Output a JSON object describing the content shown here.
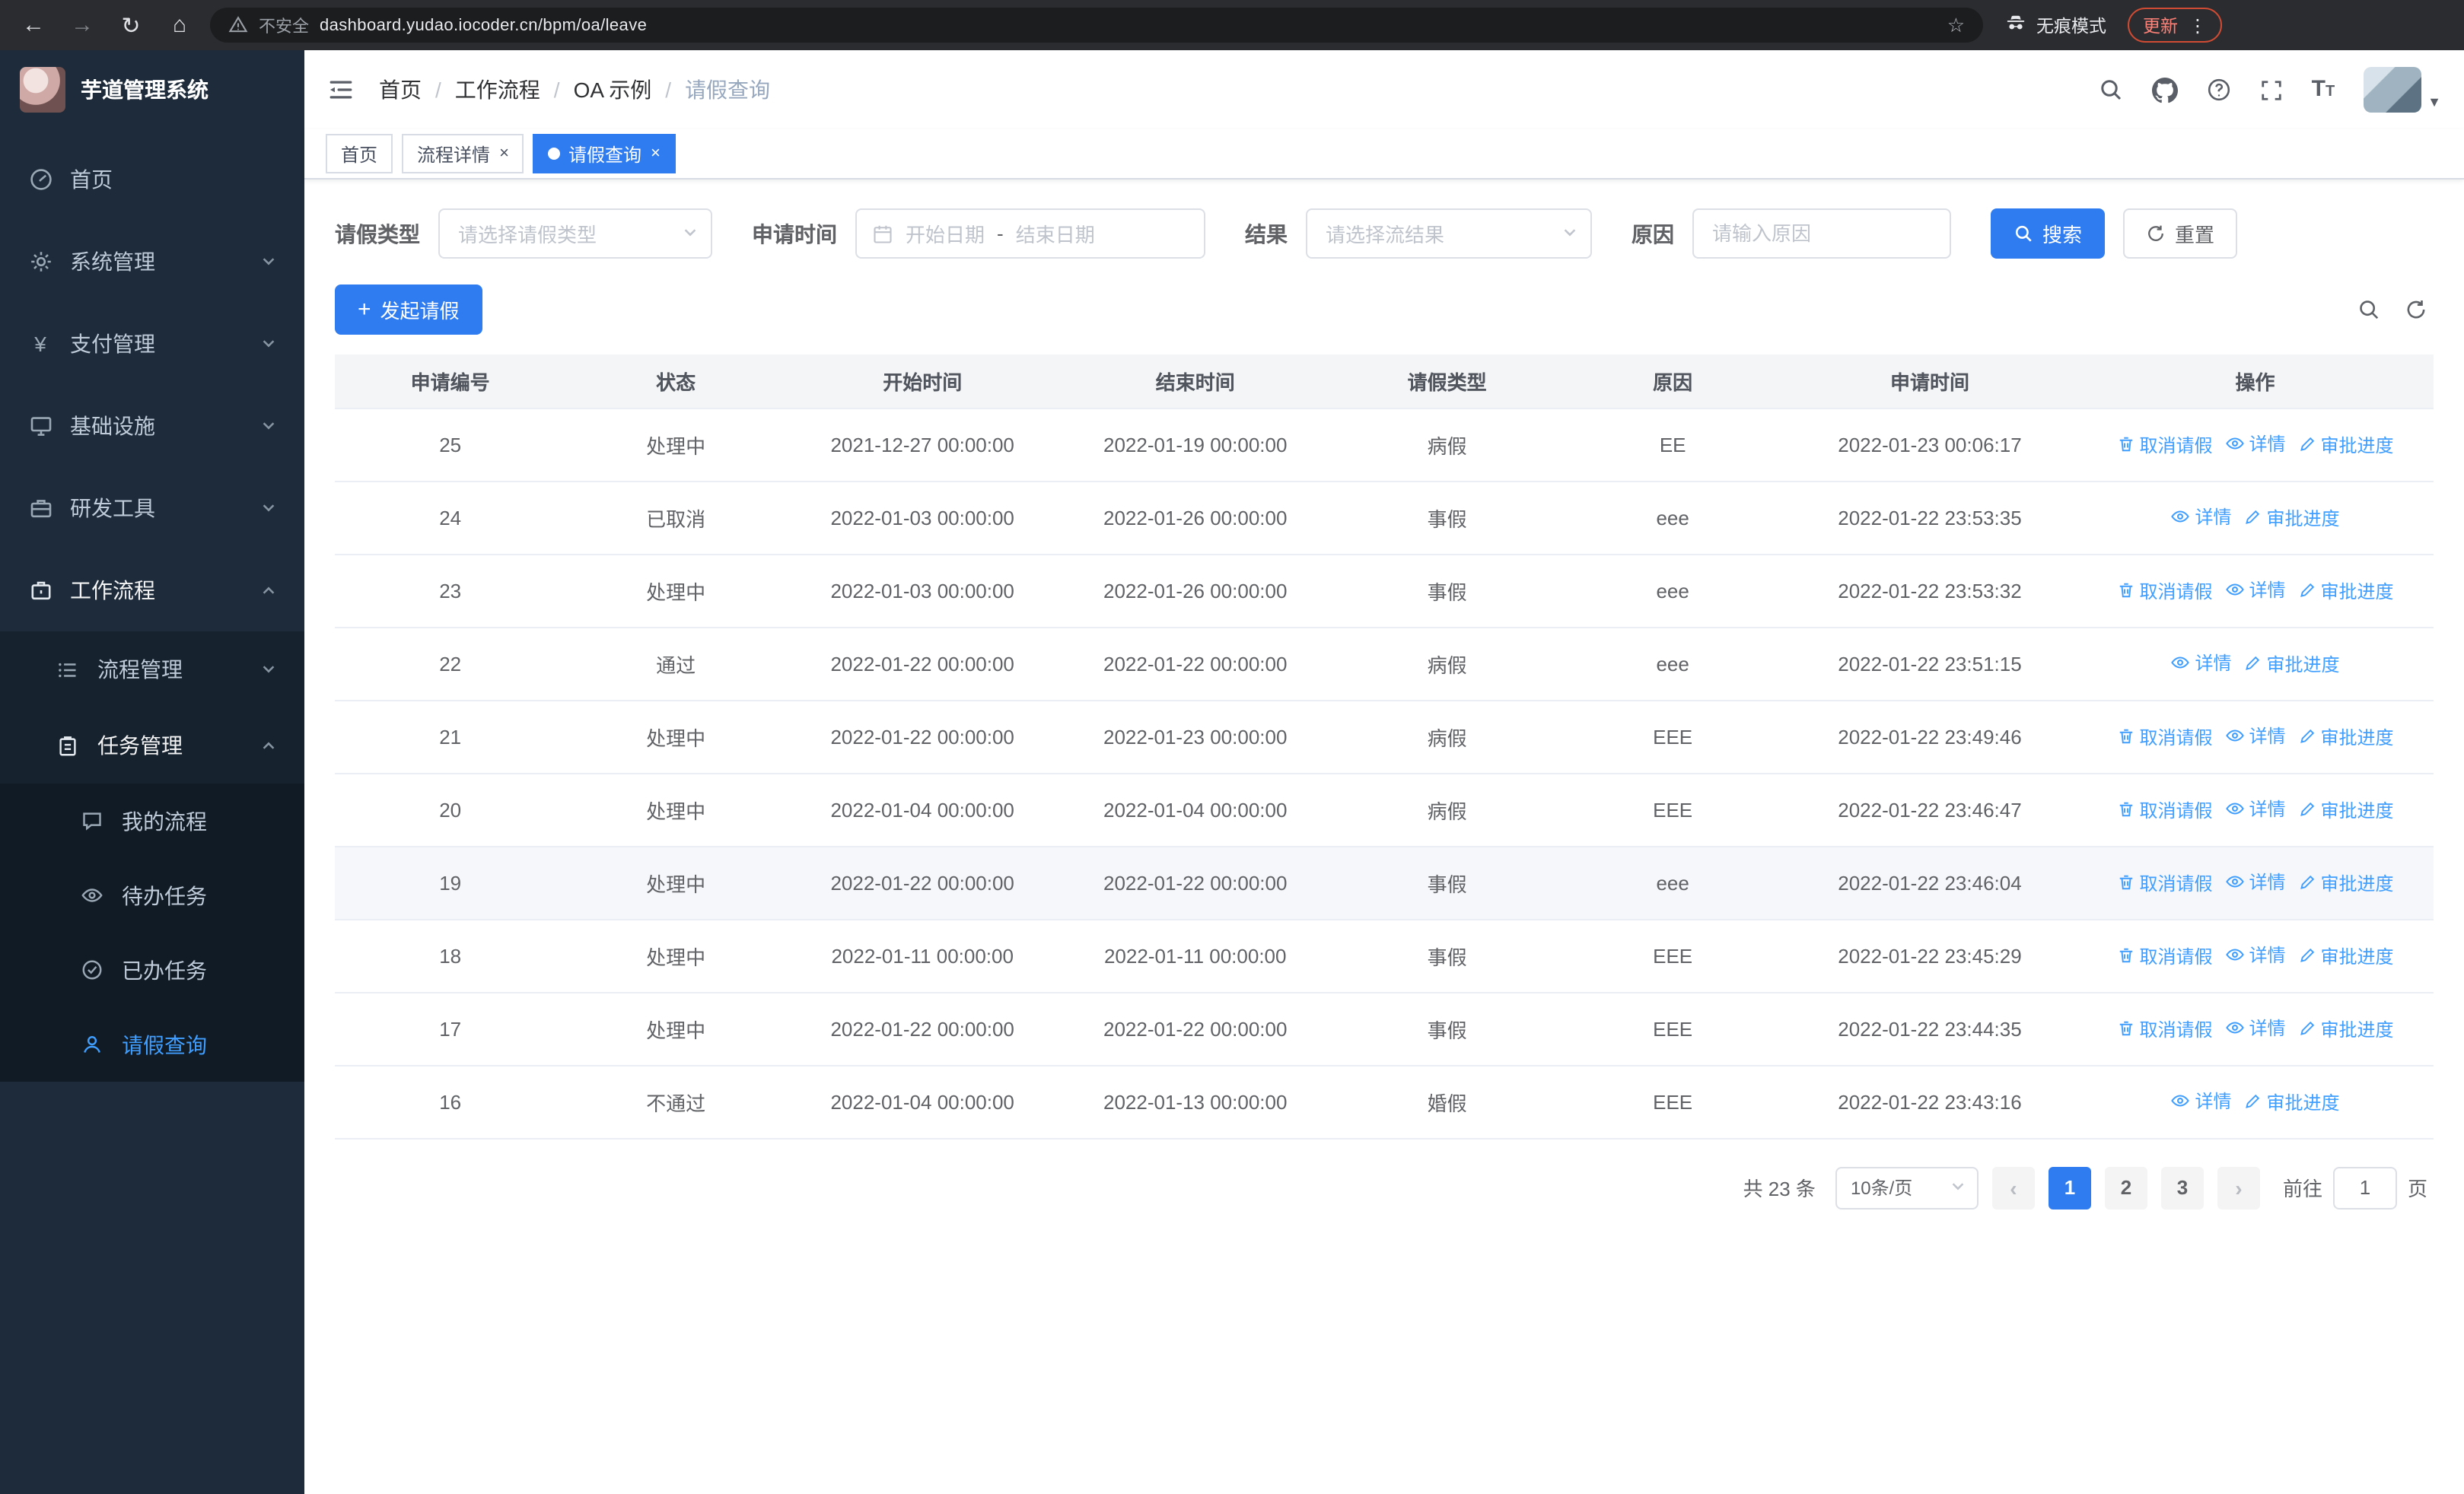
{
  "browser": {
    "security_label": "不安全",
    "url": "dashboard.yudao.iocoder.cn/bpm/oa/leave",
    "incognito_label": "无痕模式",
    "update_label": "更新"
  },
  "app_title": "芋道管理系统",
  "sidebar": {
    "items": [
      {
        "label": "首页",
        "icon": "dashboard-icon"
      },
      {
        "label": "系统管理",
        "icon": "gear-icon"
      },
      {
        "label": "支付管理",
        "icon": "yen-icon"
      },
      {
        "label": "基础设施",
        "icon": "monitor-icon"
      },
      {
        "label": "研发工具",
        "icon": "toolbox-icon"
      },
      {
        "label": "工作流程",
        "icon": "briefcase-icon"
      }
    ],
    "workflow_children": [
      {
        "label": "流程管理",
        "icon": "list-icon"
      },
      {
        "label": "任务管理",
        "icon": "clipboard-icon"
      }
    ],
    "task_children": [
      {
        "label": "我的流程",
        "icon": "chat-icon"
      },
      {
        "label": "待办任务",
        "icon": "eye-icon"
      },
      {
        "label": "已办任务",
        "icon": "check-icon"
      },
      {
        "label": "请假查询",
        "icon": "user-icon",
        "active": true
      }
    ]
  },
  "breadcrumb": {
    "items": [
      "首页",
      "工作流程",
      "OA 示例",
      "请假查询"
    ]
  },
  "tabs": [
    {
      "label": "首页",
      "closable": false,
      "active": false
    },
    {
      "label": "流程详情",
      "closable": true,
      "active": false
    },
    {
      "label": "请假查询",
      "closable": true,
      "active": true
    }
  ],
  "filters": {
    "leave_type_label": "请假类型",
    "leave_type_placeholder": "请选择请假类型",
    "apply_time_label": "申请时间",
    "start_date_placeholder": "开始日期",
    "range_separator": "-",
    "end_date_placeholder": "结束日期",
    "result_label": "结果",
    "result_placeholder": "请选择流结果",
    "reason_label": "原因",
    "reason_placeholder": "请输入原因",
    "search_button": "搜索",
    "reset_button": "重置"
  },
  "toolbar": {
    "create_button": "发起请假"
  },
  "table": {
    "columns": [
      "申请编号",
      "状态",
      "开始时间",
      "结束时间",
      "请假类型",
      "原因",
      "申请时间",
      "操作"
    ],
    "action_labels": {
      "cancel": "取消请假",
      "detail": "详情",
      "progress": "审批进度"
    },
    "rows": [
      {
        "id": "25",
        "status": "处理中",
        "start": "2021-12-27 00:00:00",
        "end": "2022-01-19 00:00:00",
        "type": "病假",
        "reason": "EE",
        "applied": "2022-01-23 00:06:17",
        "actions": [
          "cancel",
          "detail",
          "progress"
        ]
      },
      {
        "id": "24",
        "status": "已取消",
        "start": "2022-01-03 00:00:00",
        "end": "2022-01-26 00:00:00",
        "type": "事假",
        "reason": "eee",
        "applied": "2022-01-22 23:53:35",
        "actions": [
          "detail",
          "progress"
        ]
      },
      {
        "id": "23",
        "status": "处理中",
        "start": "2022-01-03 00:00:00",
        "end": "2022-01-26 00:00:00",
        "type": "事假",
        "reason": "eee",
        "applied": "2022-01-22 23:53:32",
        "actions": [
          "cancel",
          "detail",
          "progress"
        ]
      },
      {
        "id": "22",
        "status": "通过",
        "start": "2022-01-22 00:00:00",
        "end": "2022-01-22 00:00:00",
        "type": "病假",
        "reason": "eee",
        "applied": "2022-01-22 23:51:15",
        "actions": [
          "detail",
          "progress"
        ]
      },
      {
        "id": "21",
        "status": "处理中",
        "start": "2022-01-22 00:00:00",
        "end": "2022-01-23 00:00:00",
        "type": "病假",
        "reason": "EEE",
        "applied": "2022-01-22 23:49:46",
        "actions": [
          "cancel",
          "detail",
          "progress"
        ]
      },
      {
        "id": "20",
        "status": "处理中",
        "start": "2022-01-04 00:00:00",
        "end": "2022-01-04 00:00:00",
        "type": "病假",
        "reason": "EEE",
        "applied": "2022-01-22 23:46:47",
        "actions": [
          "cancel",
          "detail",
          "progress"
        ]
      },
      {
        "id": "19",
        "status": "处理中",
        "start": "2022-01-22 00:00:00",
        "end": "2022-01-22 00:00:00",
        "type": "事假",
        "reason": "eee",
        "applied": "2022-01-22 23:46:04",
        "actions": [
          "cancel",
          "detail",
          "progress"
        ],
        "highlighted": true
      },
      {
        "id": "18",
        "status": "处理中",
        "start": "2022-01-11 00:00:00",
        "end": "2022-01-11 00:00:00",
        "type": "事假",
        "reason": "EEE",
        "applied": "2022-01-22 23:45:29",
        "actions": [
          "cancel",
          "detail",
          "progress"
        ]
      },
      {
        "id": "17",
        "status": "处理中",
        "start": "2022-01-22 00:00:00",
        "end": "2022-01-22 00:00:00",
        "type": "事假",
        "reason": "EEE",
        "applied": "2022-01-22 23:44:35",
        "actions": [
          "cancel",
          "detail",
          "progress"
        ]
      },
      {
        "id": "16",
        "status": "不通过",
        "start": "2022-01-04 00:00:00",
        "end": "2022-01-13 00:00:00",
        "type": "婚假",
        "reason": "EEE",
        "applied": "2022-01-22 23:43:16",
        "actions": [
          "detail",
          "progress"
        ]
      }
    ]
  },
  "pagination": {
    "total": "共 23 条",
    "page_size": "10条/页",
    "pages": [
      "1",
      "2",
      "3"
    ],
    "active_page": "1",
    "goto_prefix": "前往",
    "goto_value": "1",
    "goto_suffix": "页"
  },
  "colors": {
    "primary": "#2e7cf0",
    "link": "#409eff",
    "sidebar_bg": "#1d2b3a"
  }
}
